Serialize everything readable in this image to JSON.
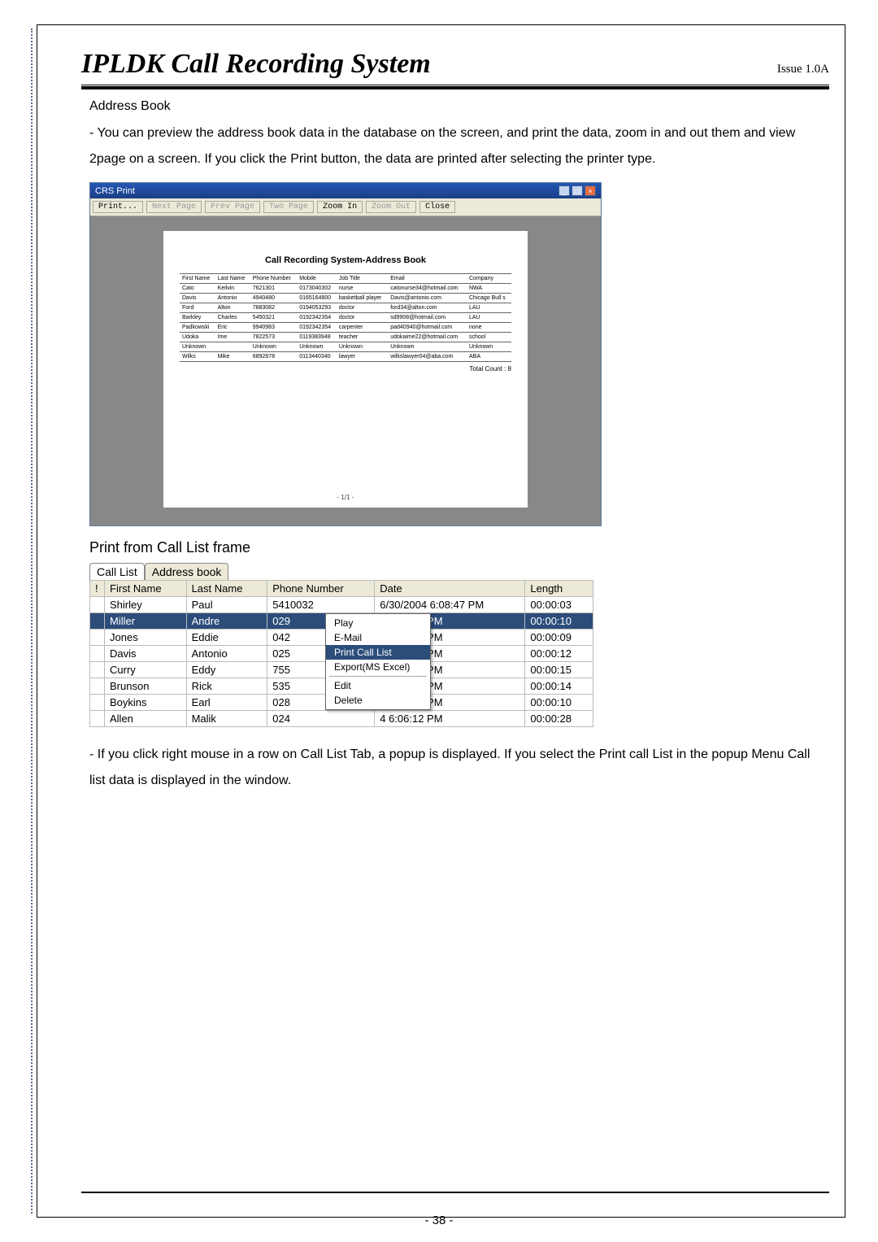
{
  "header": {
    "title": "IPLDK Call Recording System",
    "issue": "Issue 1.0A"
  },
  "section": {
    "heading": "Address Book",
    "paragraph": "- You can preview the address book data in the database on the screen, and print the data, zoom in and out them and view 2page on a screen. If you click the Print button, the data are printed after selecting the printer type."
  },
  "crs_print": {
    "window_title": "CRS Print",
    "toolbar": {
      "print": "Print...",
      "next": "Next Page",
      "prev": "Prev Page",
      "two": "Two Page",
      "zoom_in": "Zoom In",
      "zoom_out": "Zoom Out",
      "close": "Close"
    },
    "report_title": "Call Recording System-Address Book",
    "columns": [
      "First Name",
      "Last Name",
      "Phone Number",
      "Mobile",
      "Job Title",
      "Email",
      "Company"
    ],
    "rows": [
      [
        "Cato",
        "Keilvin",
        "7621301",
        "0173040302",
        "nurse",
        "catonurse34@hotmail.com",
        "NWA"
      ],
      [
        "Davis",
        "Antonio",
        "4940480",
        "0165164800",
        "basketball player",
        "Davis@antonio.com",
        "Chicago Bull s"
      ],
      [
        "Ford",
        "Alton",
        "7883082",
        "0194053293",
        "doctor",
        "ford34@alton.com",
        "LAU"
      ],
      [
        "Barkley",
        "Charles",
        "5450321",
        "0192342354",
        "doctor",
        "sd9908@hotmail.com",
        "LAU"
      ],
      [
        "Padkowski",
        "Eric",
        "9940983",
        "0192342354",
        "carpenter",
        "pad40940@hotmail.com",
        "none"
      ],
      [
        "Udoka",
        "Ime",
        "7822573",
        "0119383948",
        "teacher",
        "udokaime22@hotmail.com",
        "school"
      ],
      [
        "Unknown",
        "",
        "Unknown",
        "Unknown",
        "Unknown",
        "Unknown",
        "Unknown"
      ],
      [
        "Wilks",
        "Mike",
        "6892878",
        "0113440340",
        "lawyer",
        "wilkslawyer04@aba.com",
        "ABA"
      ]
    ],
    "total_count_label": "Total Count : 8",
    "page_marker": "- 1/1 -"
  },
  "calllist": {
    "heading": "Print from Call List frame",
    "tabs": {
      "list": "Call List",
      "addr": "Address book"
    },
    "columns": {
      "excl": "!",
      "first": "First Name",
      "last": "Last Name",
      "phone": "Phone Number",
      "date": "Date",
      "length": "Length"
    },
    "rows": [
      {
        "first": "Shirley",
        "last": "Paul",
        "phone": "5410032",
        "date": "6/30/2004 6:08:47 PM",
        "length": "00:00:03",
        "sel": false
      },
      {
        "first": "Miller",
        "last": "Andre",
        "phone": "029",
        "phone_tail": "",
        "date": "4 6:08:41 PM",
        "length": "00:00:10",
        "sel": true
      },
      {
        "first": "Jones",
        "last": "Eddie",
        "phone": "042",
        "date": "4 6:08:27 PM",
        "length": "00:00:09",
        "sel": false
      },
      {
        "first": "Davis",
        "last": "Antonio",
        "phone": "025",
        "date": "4 6:08:16 PM",
        "length": "00:00:12",
        "sel": false
      },
      {
        "first": "Curry",
        "last": "Eddy",
        "phone": "755",
        "date": "4 6:08:00 PM",
        "length": "00:00:15",
        "sel": false
      },
      {
        "first": "Brunson",
        "last": "Rick",
        "phone": "535",
        "date": "4 6:07:42 PM",
        "length": "00:00:14",
        "sel": false
      },
      {
        "first": "Boykins",
        "last": "Earl",
        "phone": "028",
        "date": "4 6:07:15 PM",
        "length": "00:00:10",
        "sel": false
      },
      {
        "first": "Allen",
        "last": "Malik",
        "phone": "024",
        "date": "4 6:06:12 PM",
        "length": "00:00:28",
        "sel": false
      }
    ],
    "context_menu": {
      "play": "Play",
      "email": "E-Mail",
      "print": "Print Call List",
      "export": "Export(MS Excel)",
      "edit": "Edit",
      "delete": "Delete"
    }
  },
  "body_after": "- If you click right mouse in a row on Call List Tab, a popup is displayed. If you select the Print call List in the popup Menu Call list data is displayed in the window.",
  "page_number": "- 38 -"
}
